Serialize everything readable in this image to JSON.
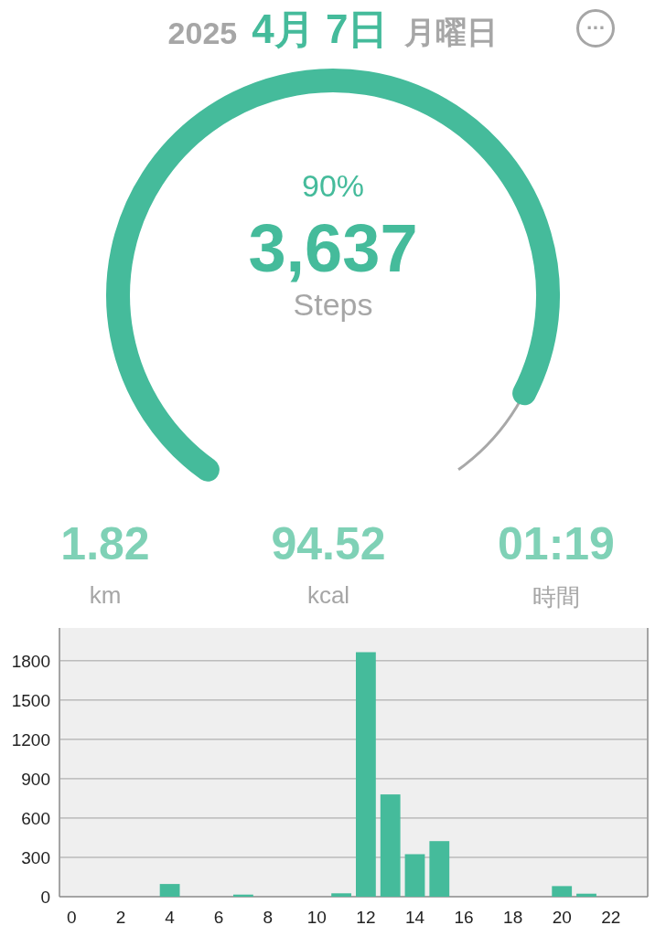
{
  "header": {
    "year": "2025",
    "month_day": "4月 7日",
    "weekday": "月曜日",
    "more_button": "···"
  },
  "goal_ring": {
    "percent": "90%",
    "steps": "3,637",
    "unit": "Steps"
  },
  "stats": [
    {
      "value": "1.82",
      "unit": "km"
    },
    {
      "value": "94.52",
      "unit": "kcal"
    },
    {
      "value": "01:19",
      "unit": "時間"
    }
  ],
  "hourly_chart": {
    "chart_data": {
      "type": "bar",
      "x": [
        4,
        7,
        11,
        12,
        13,
        14,
        15,
        20,
        21
      ],
      "grid": true,
      "xlim": [
        -0.5,
        23.5
      ],
      "series": [
        {
          "color": "#45bb9b",
          "values": [
            97,
            16,
            26,
            1865,
            780,
            324,
            424,
            81,
            23
          ]
        }
      ],
      "ylim": [
        0,
        2050
      ],
      "yticks": [
        0,
        300,
        600,
        900,
        1200,
        1500,
        1800
      ],
      "xticks": [
        0,
        2,
        4,
        6,
        8,
        10,
        12,
        14,
        16,
        18,
        20,
        22
      ]
    }
  }
}
